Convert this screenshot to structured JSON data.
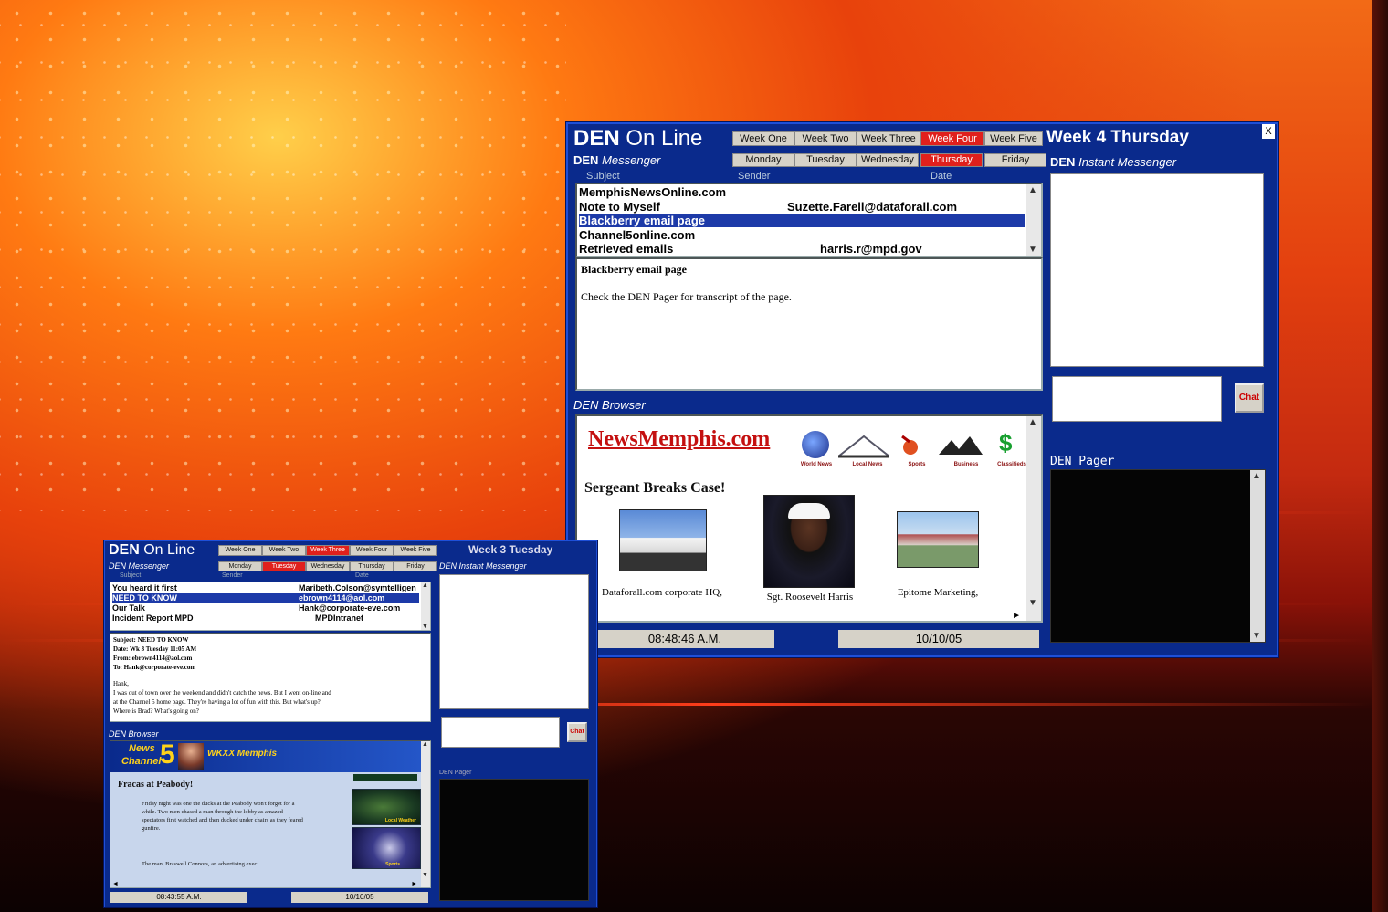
{
  "main": {
    "brand_a": "DEN",
    "brand_b": "On Line",
    "weeks": [
      "Week One",
      "Week Two",
      "Week Three",
      "Week Four",
      "Week Five"
    ],
    "active_week": 3,
    "week_day_title": "Week 4 Thursday",
    "close_label": "X",
    "messenger": {
      "title_a": "DEN",
      "title_b": "Messenger",
      "days": [
        "Monday",
        "Tuesday",
        "Wednesday",
        "Thursday",
        "Friday"
      ],
      "active_day": 3,
      "columns": [
        "Subject",
        "Sender",
        "Date"
      ],
      "rows": [
        {
          "subject": "MemphisNewsOnline.com",
          "sender": ""
        },
        {
          "subject": "Note to Myself",
          "sender": "Suzette.Farell@dataforall.com"
        },
        {
          "subject": "Blackberry email page",
          "sender": ""
        },
        {
          "subject": "Channel5online.com",
          "sender": ""
        },
        {
          "subject": "Retrieved emails",
          "sender": "harris.r@mpd.gov"
        }
      ],
      "selected_row": 2,
      "preview_title": "Blackberry email page",
      "preview_body": "Check the DEN Pager for transcript of the page."
    },
    "instant": {
      "title_a": "DEN",
      "title_b": "Instant Messenger",
      "chat_label": "Chat"
    },
    "browser": {
      "title": "DEN Browser",
      "site": "NewsMemphis.com",
      "nav": [
        "World News",
        "Local News",
        "Sports",
        "Business",
        "Classifieds"
      ],
      "headline": "Sergeant Breaks Case!",
      "captions": [
        "Dataforall.com corporate HQ, unknowing victim",
        "Sgt. Roosevelt Harris",
        "Epitome Marketing, employer of accused"
      ],
      "time": "08:48:46 A.M.",
      "date": "10/10/05"
    },
    "pager": {
      "title": "DEN Pager"
    }
  },
  "small": {
    "brand_a": "DEN",
    "brand_b": "On Line",
    "weeks": [
      "Week One",
      "Week Two",
      "Week Three",
      "Week Four",
      "Week Five"
    ],
    "active_week": 2,
    "week_day_title": "Week 3 Tuesday",
    "messenger": {
      "title": "DEN Messenger",
      "days": [
        "Monday",
        "Tuesday",
        "Wednesday",
        "Thursday",
        "Friday"
      ],
      "active_day": 1,
      "columns": [
        "Subject",
        "Sender",
        "Date"
      ],
      "rows": [
        {
          "subject": "You heard it first",
          "sender": "Maribeth.Colson@symtelligen"
        },
        {
          "subject": "NEED TO KNOW",
          "sender": "ebrown4114@aol.com"
        },
        {
          "subject": "Our Talk",
          "sender": "Hank@corporate-eve.com"
        },
        {
          "subject": "Incident Report MPD",
          "sender": "MPDIntranet"
        }
      ],
      "selected_row": 1,
      "email_lines": [
        "Subject: NEED TO KNOW",
        "Date: Wk 3 Tuesday 11:05 AM",
        "From: ebrown4114@aol.com",
        "To: Hank@corporate-eve.com",
        "Hank,",
        "I was out of town over the weekend and didn't catch the news. But I went on-line and",
        "at the Channel 5 home page. They're having a lot of fun with this. But what's up?",
        "Where is Brad? What's going on?"
      ]
    },
    "instant": {
      "title": "DEN Instant Messenger",
      "chat_label": "Chat"
    },
    "browser": {
      "title": "DEN Browser",
      "logo_a": "News",
      "logo_b": "Channel",
      "logo_num": "5",
      "station": "WKXX Memphis",
      "headline": "Fracas at Peabody!",
      "para1": "Friday night was one the ducks at the Peabody won't forget for a while. Two men chased a man through the lobby as amazed spectators first watched and then ducked under chairs as they feared gunfire.",
      "para2": "The man, Braswell Connors, an advertising exec",
      "side_labels": [
        "Local Weather",
        "Sports"
      ],
      "time": "08:43:55 A.M.",
      "date": "10/10/05"
    },
    "pager": {
      "title": "DEN Pager"
    }
  },
  "colors": {
    "window_blue": "#0a2a8c",
    "active_red": "#e0201c",
    "selection": "#1d3aa8",
    "site_red": "#c41010"
  }
}
